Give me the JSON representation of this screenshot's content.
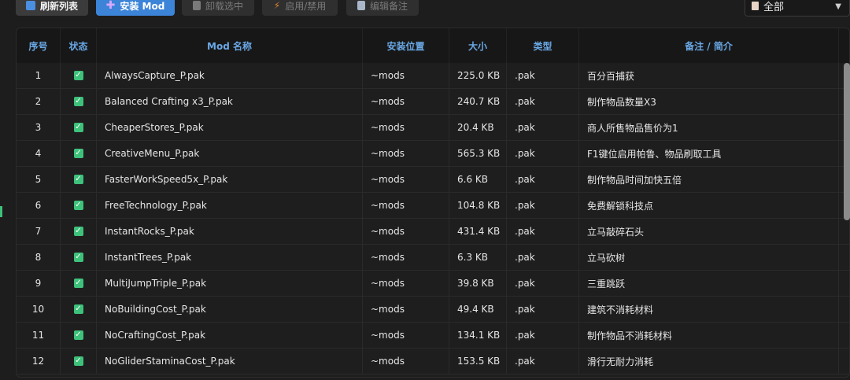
{
  "toolbar": {
    "refresh_label": "刷新列表",
    "install_label": "安装 Mod",
    "uninstall_label": "卸载选中",
    "toggle_label": "启用/禁用",
    "note_label": "编辑备注",
    "filter_value": "全部"
  },
  "table": {
    "headers": {
      "index": "序号",
      "status": "状态",
      "name": "Mod 名称",
      "location": "安装位置",
      "size": "大小",
      "type": "类型",
      "note": "备注 / 简介"
    },
    "rows": [
      {
        "index": "1",
        "checked": true,
        "name": "AlwaysCapture_P.pak",
        "location": "~mods",
        "size": "225.0 KB",
        "type": ".pak",
        "note": "百分百捕获"
      },
      {
        "index": "2",
        "checked": true,
        "name": "Balanced Crafting x3_P.pak",
        "location": "~mods",
        "size": "240.7 KB",
        "type": ".pak",
        "note": "制作物品数量X3"
      },
      {
        "index": "3",
        "checked": true,
        "name": "CheaperStores_P.pak",
        "location": "~mods",
        "size": "20.4 KB",
        "type": ".pak",
        "note": "商人所售物品售价为1"
      },
      {
        "index": "4",
        "checked": true,
        "name": "CreativeMenu_P.pak",
        "location": "~mods",
        "size": "565.3 KB",
        "type": ".pak",
        "note": "F1键位启用帕鲁、物品刷取工具"
      },
      {
        "index": "5",
        "checked": true,
        "name": "FasterWorkSpeed5x_P.pak",
        "location": "~mods",
        "size": "6.6 KB",
        "type": ".pak",
        "note": "制作物品时间加快五倍"
      },
      {
        "index": "6",
        "checked": true,
        "name": "FreeTechnology_P.pak",
        "location": "~mods",
        "size": "104.8 KB",
        "type": ".pak",
        "note": "免费解锁科技点"
      },
      {
        "index": "7",
        "checked": true,
        "name": "InstantRocks_P.pak",
        "location": "~mods",
        "size": "431.4 KB",
        "type": ".pak",
        "note": "立马敲碎石头"
      },
      {
        "index": "8",
        "checked": true,
        "name": "InstantTrees_P.pak",
        "location": "~mods",
        "size": "6.3 KB",
        "type": ".pak",
        "note": "立马砍树"
      },
      {
        "index": "9",
        "checked": true,
        "name": "MultiJumpTriple_P.pak",
        "location": "~mods",
        "size": "39.8 KB",
        "type": ".pak",
        "note": "三重跳跃"
      },
      {
        "index": "10",
        "checked": true,
        "name": "NoBuildingCost_P.pak",
        "location": "~mods",
        "size": "49.4 KB",
        "type": ".pak",
        "note": "建筑不消耗材料"
      },
      {
        "index": "11",
        "checked": true,
        "name": "NoCraftingCost_P.pak",
        "location": "~mods",
        "size": "134.1 KB",
        "type": ".pak",
        "note": "制作物品不消耗材料"
      },
      {
        "index": "12",
        "checked": true,
        "name": "NoGliderStaminaCost_P.pak",
        "location": "~mods",
        "size": "153.5 KB",
        "type": ".pak",
        "note": "滑行无耐力消耗"
      }
    ]
  },
  "colors": {
    "accent": "#3c84d8",
    "header_text": "#6aa8e6",
    "checkbox": "#3ec17a"
  }
}
